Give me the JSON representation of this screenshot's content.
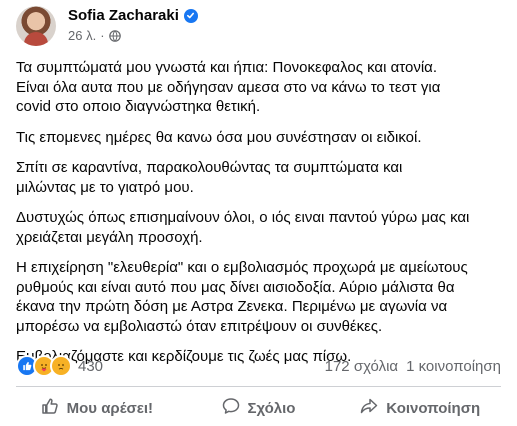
{
  "author": {
    "name": "Sofia Zacharaki",
    "time": "26 λ.",
    "separator": "·"
  },
  "post": {
    "paragraphs": [
      "Τα συμπτώματά μου γνωστά και ήπια: Πονοκεφαλος και ατονία.\nΕίναι όλα αυτα που με οδήγησαν αμεσα στο να κάνω το τεστ για\ncovid στο οποιο διαγνώστηκα θετική.",
      "Τις επομενες ημέρες θα κανω όσα μου συνέστησαν οι ειδικοί.",
      "Σπίτι σε καραντίνα, παρακολουθώντας τα συμπτώματα και\nμιλώντας με το γιατρό μου.",
      "Δυστυχώς όπως επισημαίνουν όλοι, ο ιός ειναι παντού γύρω μας και\nχρειάζεται μεγάλη προσοχή.",
      "Η επιχείρηση \"ελευθερία\"  και ο εμβολιασμός προχωρά με αμείωτους\nρυθμούς και είναι αυτό που μας δίνει αισιοδοξία. Αύριο μάλιστα θα\nέκανα την πρώτη δόση με Αστρα Ζενεκα. Περιμένω με αγωνία να\nμπορέσω να εμβολιαστώ όταν επιτρέψουν οι συνθέκες.",
      "Εμβολιαζόμαστε και κερδίζουμε τις ζωές μας πίσω."
    ]
  },
  "reactions": {
    "icons": [
      "like-reaction-icon",
      "care-reaction-icon",
      "sad-reaction-icon"
    ],
    "count": "430",
    "comments": "172 σχόλια",
    "shares": "1 κοινοποίηση"
  },
  "actions": {
    "like": "Μου αρέσει!",
    "comment": "Σχόλιο",
    "share": "Κοινοποίηση"
  },
  "colors": {
    "accent": "#1877f2",
    "secondary_text": "#65676b",
    "divider": "#ced0d4"
  }
}
